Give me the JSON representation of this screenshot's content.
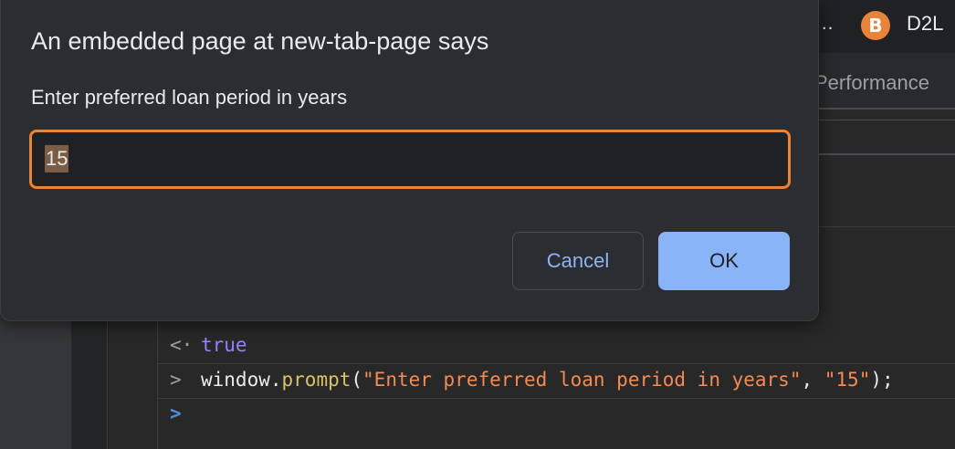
{
  "browser": {
    "tab_ellipsis": "...",
    "profile_tab_label": "D2L",
    "profile_icon_glyph": "B",
    "icon": "d2l-brightspace-icon"
  },
  "devtools": {
    "visible_tab": "Performance"
  },
  "console": {
    "lines": [
      {
        "glyph": "<·",
        "value": "true"
      },
      {
        "glyph": ">",
        "code_obj": "window",
        "code_dot": ".",
        "code_fn": "prompt",
        "code_open": "(",
        "code_arg1": "\"Enter preferred loan period in years\"",
        "code_comma": ", ",
        "code_arg2": "\"15\"",
        "code_close": ");"
      },
      {
        "glyph": ">"
      }
    ]
  },
  "dialog": {
    "title": "An embedded page at new-tab-page says",
    "message": "Enter preferred loan period in years",
    "input_value": "15",
    "cancel_label": "Cancel",
    "ok_label": "OK"
  },
  "colors": {
    "accent_focus": "#e8833a",
    "primary_button": "#8ab4f8",
    "dialog_bg": "#2c2d30"
  }
}
